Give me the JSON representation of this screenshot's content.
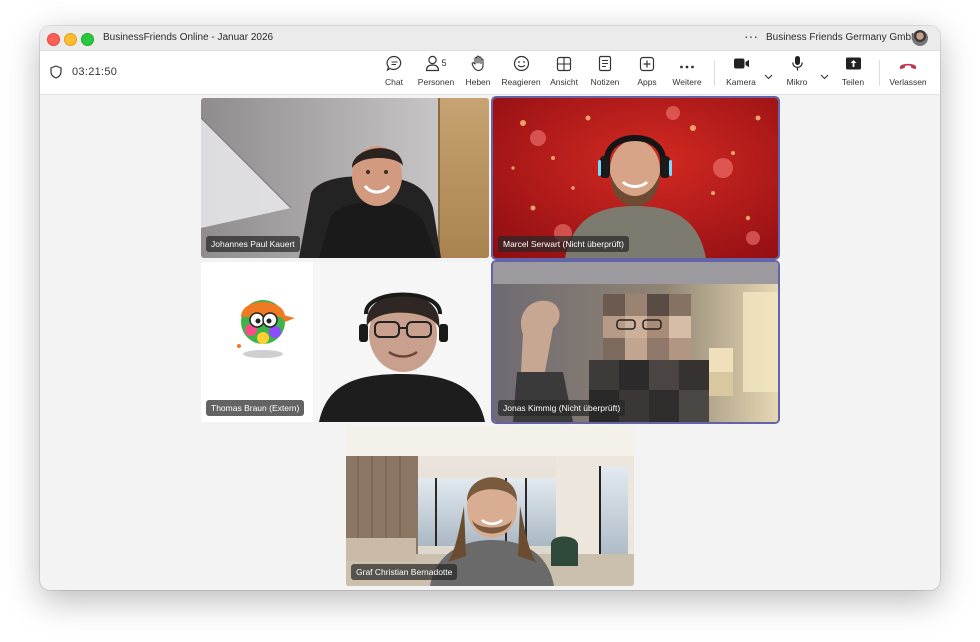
{
  "window": {
    "title": "BusinessFriends Online - Januar 2026",
    "more_glyph": "···",
    "organization": "Business Friends Germany GmbH"
  },
  "toolbar": {
    "timer": "03:21:50",
    "chat": "Chat",
    "people": "Personen",
    "people_count": "5",
    "raise": "Heben",
    "react": "Reagieren",
    "view": "Ansicht",
    "notes": "Notizen",
    "apps": "Apps",
    "more": "Weitere",
    "camera": "Kamera",
    "mic": "Mikro",
    "share": "Teilen",
    "leave": "Verlassen",
    "leave_color": "#c4314b"
  },
  "participants": [
    {
      "name": "Johannes Paul Kauert",
      "speaking": false
    },
    {
      "name": "Marcel Serwart (Nicht überprüft)",
      "speaking": true
    },
    {
      "name": "Thomas Braun (Extern)",
      "speaking": false
    },
    {
      "name": "Jonas Kimmig (Nicht überprüft)",
      "speaking": true
    },
    {
      "name": "Graf Christian Bernadotte",
      "speaking": false
    }
  ],
  "colors": {
    "accent": "#6264a7",
    "stage_bg": "#f3f3f3",
    "red_background": "#b3121b"
  }
}
